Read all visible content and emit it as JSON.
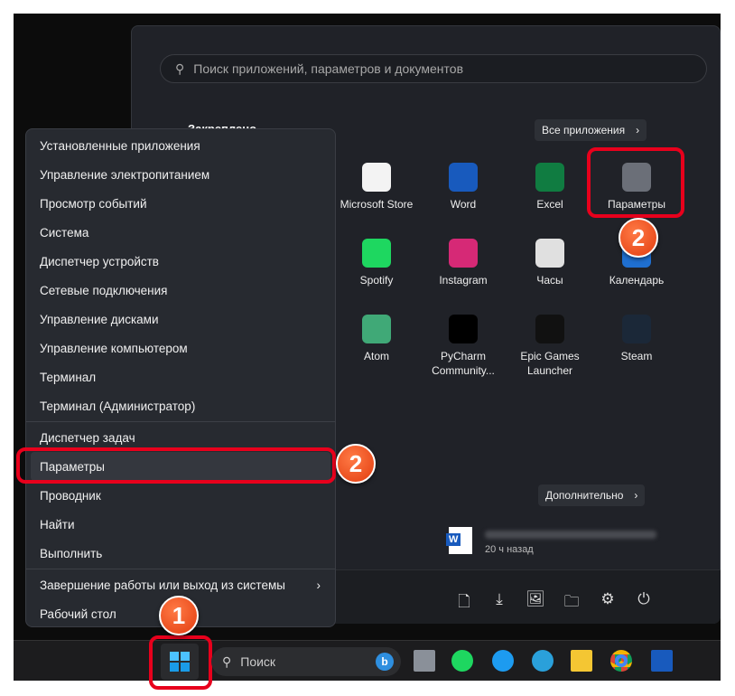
{
  "start": {
    "search_placeholder": "Поиск приложений, параметров и документов",
    "pinned_label": "Закреплено",
    "all_apps": "Все приложения",
    "more": "Дополнительно",
    "apps": [
      {
        "label": "Microsoft Store",
        "icon": "microsoft-store-icon",
        "color": "#f3f3f3"
      },
      {
        "label": "Word",
        "icon": "word-icon",
        "color": "#185abd"
      },
      {
        "label": "Excel",
        "icon": "excel-icon",
        "color": "#107c41"
      },
      {
        "label": "Параметры",
        "icon": "settings-icon",
        "color": "#6b6f78"
      },
      {
        "label": "Spotify",
        "icon": "spotify-icon",
        "color": "#1ed760"
      },
      {
        "label": "Instagram",
        "icon": "instagram-icon",
        "color": "#d62976"
      },
      {
        "label": "Часы",
        "icon": "clock-icon",
        "color": "#e0e0e0"
      },
      {
        "label": "Календарь",
        "icon": "calendar-icon",
        "color": "#1f6fd0"
      },
      {
        "label": "Atom",
        "icon": "atom-icon",
        "color": "#40a977"
      },
      {
        "label": "PyCharm Community...",
        "icon": "pycharm-icon",
        "color": "#000000"
      },
      {
        "label": "Epic Games Launcher",
        "icon": "epic-games-icon",
        "color": "#111111"
      },
      {
        "label": "Steam",
        "icon": "steam-icon",
        "color": "#1b2838"
      }
    ],
    "recent": {
      "time": "20 ч назад"
    }
  },
  "menu": {
    "groups": [
      [
        "Установленные приложения",
        "Управление электропитанием",
        "Просмотр событий",
        "Система",
        "Диспетчер устройств",
        "Сетевые подключения",
        "Управление дисками",
        "Управление компьютером",
        "Терминал",
        "Терминал (Администратор)"
      ],
      [
        "Диспетчер задач",
        "Параметры",
        "Проводник",
        "Найти",
        "Выполнить"
      ],
      [
        "Завершение работы или выход из системы",
        "Рабочий стол"
      ]
    ]
  },
  "taskbar": {
    "search": "Поиск"
  },
  "badges": {
    "one": "1",
    "two": "2"
  },
  "colors": {
    "highlight": "#e8001c",
    "badge": "#e8461a"
  }
}
